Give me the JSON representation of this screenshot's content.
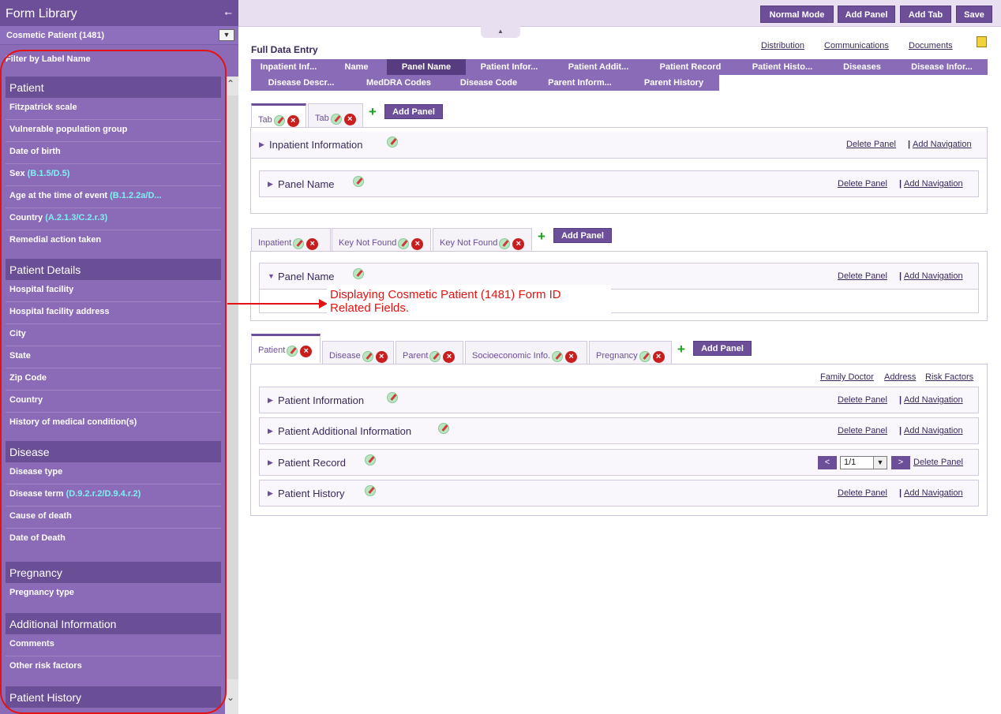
{
  "sidebar": {
    "title": "Form Library",
    "form_selector": "Cosmetic Patient (1481)",
    "filter_label": "Filter by Label Name",
    "groups": [
      {
        "title": "Patient",
        "items": [
          {
            "label": "Fitzpatrick scale",
            "code": ""
          },
          {
            "label": "Vulnerable population group",
            "code": ""
          },
          {
            "label": "Date of birth",
            "code": ""
          },
          {
            "label": "Sex",
            "code": "(B.1.5/D.5)"
          },
          {
            "label": "Age at the time of event",
            "code": "(B.1.2.2a/D..."
          },
          {
            "label": "Country",
            "code": "(A.2.1.3/C.2.r.3)"
          },
          {
            "label": "Remedial action taken",
            "code": ""
          }
        ]
      },
      {
        "title": "Patient Details",
        "items": [
          {
            "label": "Hospital facility",
            "code": ""
          },
          {
            "label": "Hospital facility address",
            "code": ""
          },
          {
            "label": "City",
            "code": ""
          },
          {
            "label": "State",
            "code": ""
          },
          {
            "label": "Zip Code",
            "code": ""
          },
          {
            "label": "Country",
            "code": ""
          },
          {
            "label": "History of medical condition(s)",
            "code": ""
          }
        ]
      },
      {
        "title": "Disease",
        "items": [
          {
            "label": "Disease type",
            "code": ""
          },
          {
            "label": "Disease term",
            "code": "(D.9.2.r.2/D.9.4.r.2)"
          },
          {
            "label": "Cause of death",
            "code": ""
          },
          {
            "label": "Date of Death",
            "code": ""
          }
        ]
      },
      {
        "title": "Pregnancy",
        "items": [
          {
            "label": "Pregnancy type",
            "code": ""
          }
        ]
      },
      {
        "title": "Additional Information",
        "items": [
          {
            "label": "Comments",
            "code": ""
          },
          {
            "label": "Other risk factors",
            "code": ""
          }
        ]
      },
      {
        "title": "Patient History",
        "items": []
      }
    ]
  },
  "toolbar": {
    "normal_mode": "Normal Mode",
    "add_panel": "Add Panel",
    "add_tab": "Add Tab",
    "save": "Save"
  },
  "main": {
    "title": "Full Data Entry",
    "top_links": [
      "Distribution",
      "Communications",
      "Documents"
    ],
    "breadcrumb_row1": [
      "Inpatient Inf...",
      "Name",
      "Panel Name",
      "Patient Infor...",
      "Patient Addit...",
      "Patient Record",
      "Patient Histo...",
      "Diseases",
      "Disease Infor..."
    ],
    "breadcrumb_row2": [
      "Disease Descr...",
      "MedDRA Codes",
      "Disease Code",
      "Parent Inform...",
      "Parent History"
    ],
    "section1": {
      "tabs": [
        "Tab",
        "Tab"
      ],
      "add_panel": "Add Panel",
      "panels": [
        "Inpatient Information",
        "Panel Name"
      ]
    },
    "section2": {
      "tabs": [
        "Inpatient",
        "Key Not Found",
        "Key Not Found"
      ],
      "add_panel": "Add Panel",
      "panels": [
        "Panel Name"
      ]
    },
    "section3": {
      "tabs": [
        "Patient",
        "Disease",
        "Parent",
        "Socioeconomic Info.",
        "Pregnancy"
      ],
      "add_panel": "Add Panel",
      "nav_links": [
        "Family Doctor",
        "Address",
        "Risk Factors"
      ],
      "panels": [
        "Patient Information",
        "Patient Additional Information",
        "Patient Record",
        "Patient History"
      ],
      "pager_value": "1/1"
    },
    "delete_panel": "Delete Panel",
    "add_navigation": "Add Navigation",
    "separator": "|",
    "prev": "<",
    "next": ">"
  },
  "callout": {
    "line1": "Displaying Cosmetic Patient (1481) Form ID",
    "line2": "Related Fields."
  },
  "colors": {
    "accent": "#6c4f98",
    "sidebar": "#8b6bb8",
    "code_text": "#7ff0f0",
    "annotation": "#e41313"
  }
}
